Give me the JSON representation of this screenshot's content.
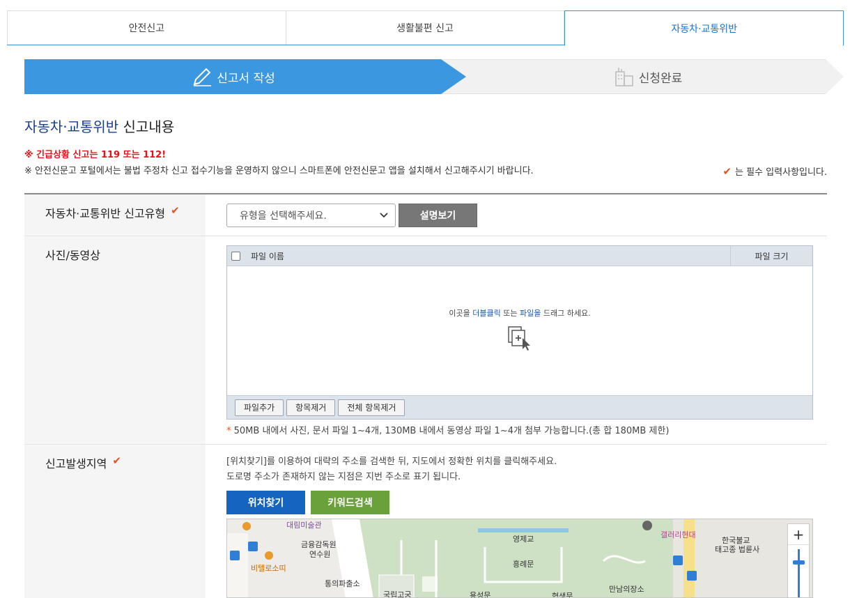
{
  "tabs": [
    {
      "label": "안전신고",
      "active": false
    },
    {
      "label": "생활불편 신고",
      "active": false
    },
    {
      "label": "자동차·교통위반",
      "active": true
    }
  ],
  "steps": {
    "step1": "신고서 작성",
    "step2": "신청완료"
  },
  "section": {
    "title_highlight": "자동차·교통위반",
    "title_rest": " 신고내용"
  },
  "emergency": {
    "prefix": "※ 긴급상황 신고는 ",
    "n1": "119",
    "mid": " 또는 ",
    "n2": "112!"
  },
  "notice": "※ 안전신문고 포털에서는 불법 주정차 신고 접수기능을 운영하지 않으니 스마트폰에 안전신문고 앱을 설치해서 신고해주시기 바랍니다.",
  "required_note": "는 필수 입력사항입니다.",
  "form": {
    "type_label": "자동차·교통위반 신고유형",
    "type_select": "유형을 선택해주세요.",
    "explain_btn": "설명보기",
    "media_label": "사진/동영상",
    "file_name_header": "파일 이름",
    "file_size_header": "파일 크기",
    "drop_prefix": "이곳을 ",
    "drop_dbl": "더블클릭",
    "drop_or": " 또는 ",
    "drop_file": "파일을",
    "drop_suffix": " 드래그 하세요.",
    "add_file": "파일추가",
    "remove_item": "항목제거",
    "remove_all": "전체 항목제거",
    "limit_star": "*",
    "limit_text": " 50MB 내에서 사진, 문서 파일 1~4개, 130MB 내에서 동영상 파일 1~4개 첨부 가능합니다.(총 합 180MB 제한)",
    "location_label": "신고발생지역",
    "loc_line1": "[위치찾기]를 이용하여 대략의 주소를 검색한 뒤, 지도에서 정확한 위치를 클릭해주세요.",
    "loc_line2": "도로명 주소가 존재하지 않는 지점은 지번 주소로 표기 됩니다.",
    "find_location": "위치찾기",
    "keyword_search": "키워드검색"
  },
  "map": {
    "labels": [
      "대림미술관",
      "금융감독원",
      "연수원",
      "비텔로소띠",
      "통의파출소",
      "영제교",
      "흥례문",
      "갤러리현대",
      "한국불교",
      "태고종 법륜사",
      "만남의장소",
      "국립고궁",
      "용성문",
      "협생문"
    ],
    "zoom_in": "+"
  },
  "colors": {
    "accent": "#3a97e0",
    "tab_active": "#1a73c7",
    "emergency": "#e3131b",
    "check": "#e8531d",
    "btn_blue": "#1565c0",
    "btn_green": "#6aa13a"
  }
}
